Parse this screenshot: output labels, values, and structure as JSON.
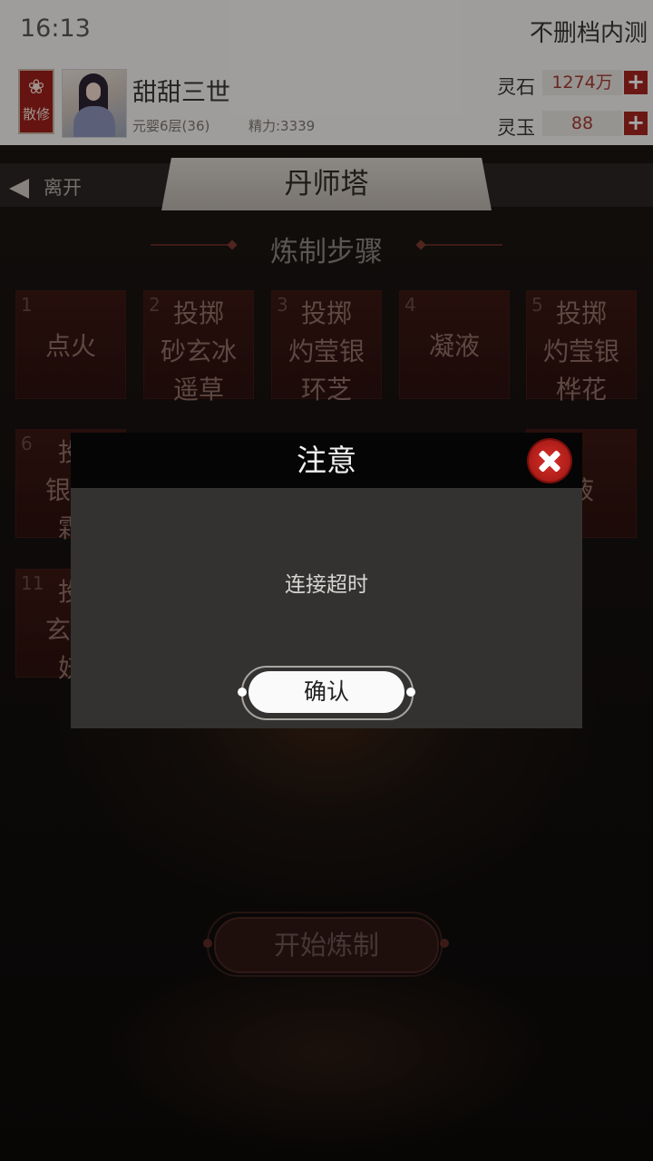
{
  "status": {
    "time": "16:13",
    "server": "不删档内测"
  },
  "player": {
    "sect_label": "散修",
    "name": "甜甜三世",
    "level": "元婴6层(36)",
    "energy": "精力:3339"
  },
  "currency": [
    {
      "label": "灵石",
      "value": "1274万"
    },
    {
      "label": "灵玉",
      "value": "88"
    }
  ],
  "nav": {
    "leave": "离开",
    "title": "丹师塔"
  },
  "section_title": "炼制步骤",
  "steps": [
    {
      "num": "1",
      "lines": [
        "点火"
      ]
    },
    {
      "num": "2",
      "lines": [
        "投掷",
        "砂玄冰",
        "遥草"
      ]
    },
    {
      "num": "3",
      "lines": [
        "投掷",
        "灼莹银",
        "环芝"
      ]
    },
    {
      "num": "4",
      "lines": [
        "凝液"
      ]
    },
    {
      "num": "5",
      "lines": [
        "投掷",
        "灼莹银",
        "桦花"
      ]
    },
    {
      "num": "6",
      "lines": [
        "投",
        "银离",
        "霜"
      ]
    },
    {
      "num": "",
      "lines": [
        "液"
      ]
    },
    {
      "num": "11",
      "lines": [
        "投",
        "玄罡",
        "妖"
      ]
    }
  ],
  "start_button": "开始炼制",
  "dialog": {
    "title": "注意",
    "message": "连接超时",
    "confirm": "确认"
  },
  "colors": {
    "accent": "#a52520",
    "dialog_bg": "#333231",
    "dialog_head": "#050505"
  }
}
